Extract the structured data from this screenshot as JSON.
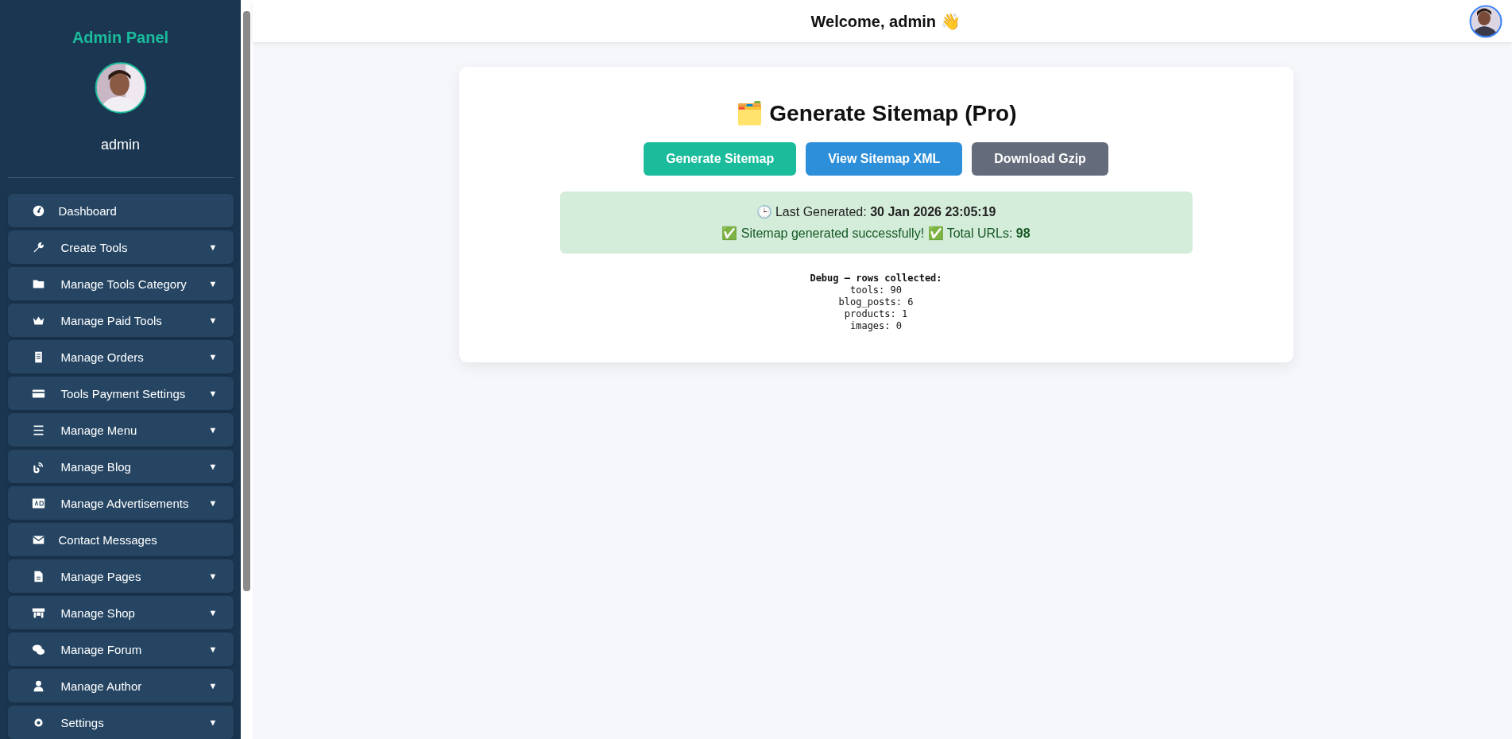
{
  "sidebar": {
    "title": "Admin Panel",
    "user": "admin",
    "items": [
      {
        "label": "Dashboard",
        "kind": "link"
      },
      {
        "label": "Create Tools",
        "kind": "submenu"
      },
      {
        "label": "Manage Tools Category",
        "kind": "submenu"
      },
      {
        "label": "Manage Paid Tools",
        "kind": "submenu"
      },
      {
        "label": "Manage Orders",
        "kind": "submenu"
      },
      {
        "label": "Tools Payment Settings",
        "kind": "submenu"
      },
      {
        "label": "Manage Menu",
        "kind": "submenu"
      },
      {
        "label": "Manage Blog",
        "kind": "submenu"
      },
      {
        "label": "Manage Advertisements",
        "kind": "submenu"
      },
      {
        "label": "Contact Messages",
        "kind": "link"
      },
      {
        "label": "Manage Pages",
        "kind": "submenu"
      },
      {
        "label": "Manage Shop",
        "kind": "submenu"
      },
      {
        "label": "Manage Forum",
        "kind": "submenu"
      },
      {
        "label": "Manage Author",
        "kind": "submenu"
      },
      {
        "label": "Settings",
        "kind": "submenu"
      }
    ],
    "arrow": "▼"
  },
  "header": {
    "greeting": "Welcome, admin 👋"
  },
  "card": {
    "title": "🗂️ Generate Sitemap (Pro)",
    "buttons": [
      {
        "label": "Generate Sitemap",
        "color": "#1abc9c"
      },
      {
        "label": "View Sitemap XML",
        "color": "#2d8fd9"
      },
      {
        "label": "Download Gzip",
        "color": "#646b7a"
      }
    ],
    "status": {
      "last_generated": "🕒 Last Generated: **30 Jan 2026 23:05:19**",
      "message": "✅ Sitemap generated successfully! ✅ Total URLs: **98**"
    },
    "debug": {
      "heading": "Debug — rows collected:",
      "lines": [
        "tools: 90",
        "blog_posts: 6",
        "products: 1",
        "images: 0"
      ]
    }
  }
}
